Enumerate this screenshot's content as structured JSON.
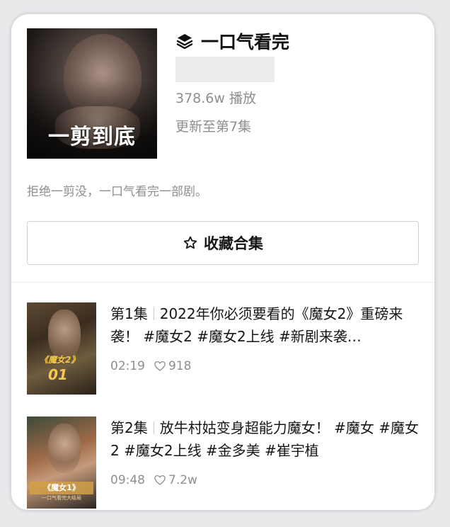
{
  "collection": {
    "cover_text": "一剪到底",
    "title": "一口气看完",
    "plays": "378.6w 播放",
    "update_status": "更新至第7集",
    "description": "拒绝一剪没，一口气看完一部剧。",
    "collect_button": "收藏合集"
  },
  "episodes": [
    {
      "number": "第1集",
      "title": "2022年你必须要看的《魔女2》重磅来袭！ #魔女2 #魔女2上线 #新剧来袭…",
      "duration": "02:19",
      "likes": "918",
      "thumb_logo": "《魔女2》",
      "thumb_num": "01"
    },
    {
      "number": "第2集",
      "title": "放牛村姑变身超能力魔女！ #魔女 #魔女2 #魔女2上线 #金多美 #崔宇植",
      "duration": "09:48",
      "likes": "7.2w",
      "thumb_banner": "《魔女1》",
      "thumb_sub": "一口气看完大结局"
    }
  ],
  "icons": {
    "title_icon": "layers-icon",
    "button_icon": "star-outline-icon",
    "like_icon": "heart-outline-icon"
  },
  "colors": {
    "card_bg": "#ffffff",
    "muted_text": "#8e8e93",
    "primary_text": "#161616",
    "thumb_accent": "#f4c848"
  }
}
